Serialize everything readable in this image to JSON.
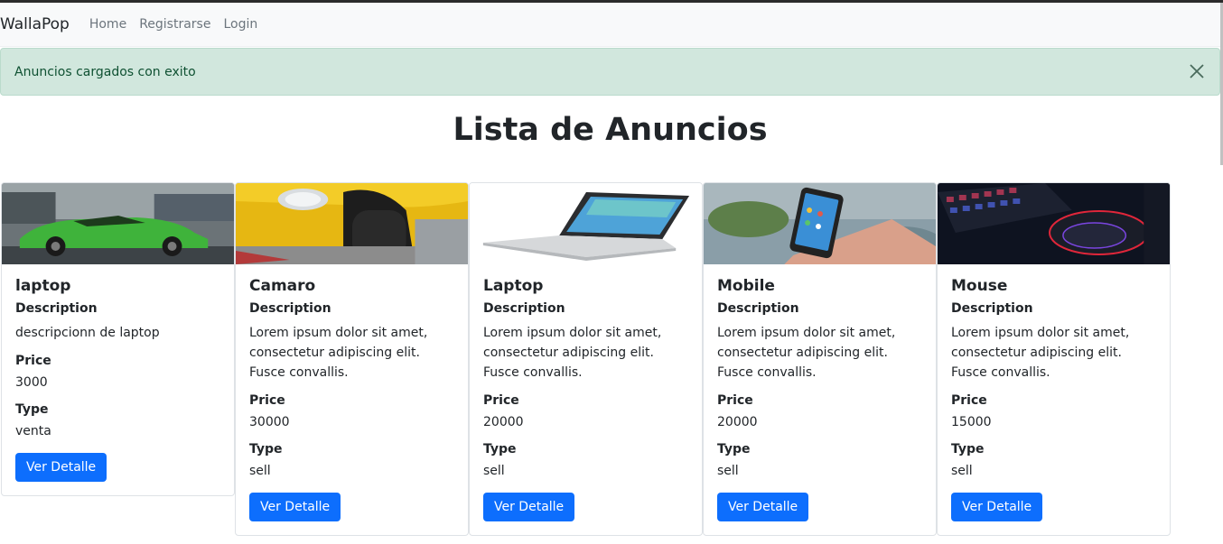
{
  "navbar": {
    "brand": "WallaPop",
    "links": [
      "Home",
      "Registrarse",
      "Login"
    ]
  },
  "alert": {
    "message": "Anuncios cargados con exito"
  },
  "page": {
    "title": "Lista de Anuncios"
  },
  "labels": {
    "description": "Description",
    "price": "Price",
    "type": "Type",
    "button": "Ver Detalle"
  },
  "ads": [
    {
      "name": "laptop",
      "description": "descripcionn de laptop",
      "price": "3000",
      "type": "venta",
      "image": "green-sports-car"
    },
    {
      "name": "Camaro",
      "description": "Lorem ipsum dolor sit amet, consectetur adipiscing elit. Fusce convallis.",
      "price": "30000",
      "type": "sell",
      "image": "yellow-car"
    },
    {
      "name": "Laptop",
      "description": "Lorem ipsum dolor sit amet, consectetur adipiscing elit. Fusce convallis.",
      "price": "20000",
      "type": "sell",
      "image": "laptop"
    },
    {
      "name": "Mobile",
      "description": "Lorem ipsum dolor sit amet, consectetur adipiscing elit. Fusce convallis.",
      "price": "20000",
      "type": "sell",
      "image": "smartphone"
    },
    {
      "name": "Mouse",
      "description": "Lorem ipsum dolor sit amet, consectetur adipiscing elit. Fusce convallis.",
      "price": "15000",
      "type": "sell",
      "image": "gaming-mouse"
    }
  ],
  "colors": {
    "primary": "#0d6efd",
    "alert_bg": "#d1e7dd",
    "alert_text": "#0f5132"
  }
}
